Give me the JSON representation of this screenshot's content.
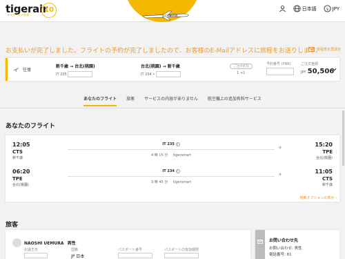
{
  "header": {
    "logo": "tigerair",
    "logo_sub": "タイガーエア台湾",
    "anniversary": "10",
    "plane_text": "tigerair",
    "language": "日本語",
    "currency": "JPY"
  },
  "banner": {
    "message": "お支払いが完了しました。フライトの予約が完了しましたので、お客様のE-Mailアドレスに旅程をお送りします。",
    "change_link": "旅程表を再送信"
  },
  "booking": {
    "trip_type": "往復",
    "out_route": "新千歳 → 台北(桃園)",
    "out_flight": "IT 235",
    "ret_route": "台北(桃園) → 新千歳",
    "ret_flight": "IT 234 •",
    "pax_tag": "ご注文状況",
    "pax_count": "1 +1",
    "pnr_label": "予約番号 (PNR)",
    "total_label": "ご注文金額",
    "currency": "JPY",
    "total": "50,506"
  },
  "tabs": [
    {
      "label": "あなたのフライト"
    },
    {
      "label": "旅客"
    },
    {
      "label": "サービスの内容がありません"
    },
    {
      "label": "航空機上の追加有料サービス"
    }
  ],
  "flights_section": {
    "title": "あなたのフライト",
    "more_link": "搭乗オプションの表示"
  },
  "flights": [
    {
      "dep_time": "12:05",
      "dep_code": "CTS",
      "dep_city": "新千歳",
      "flight_no": "IT 235",
      "duration": "4 時 15 分",
      "operator": "tigersmart",
      "arr_time": "15:20",
      "arr_code": "TPE",
      "arr_city": "台北(桃園)"
    },
    {
      "dep_time": "06:20",
      "dep_code": "TPE",
      "dep_city": "台北(桃園)",
      "flight_no": "IT 234",
      "duration": "3 時 45 分",
      "operator": "tigersmart",
      "arr_time": "11:05",
      "arr_code": "CTS",
      "arr_city": "新千歳"
    }
  ],
  "passengers_section": {
    "title": "旅客",
    "name": "NAOSHI UEMURA",
    "gender": "男性",
    "f_birth": "お誕生日",
    "f_nationality": "国籍",
    "nationality": "JP 日本",
    "f_passport": "パスポート番号",
    "f_passport_exp": "パスポートの有効期限"
  },
  "contact": {
    "title": "お問い合わせ先",
    "name_label": "お問い合わせ: 男性",
    "phone_label": "電話番号: 81"
  }
}
